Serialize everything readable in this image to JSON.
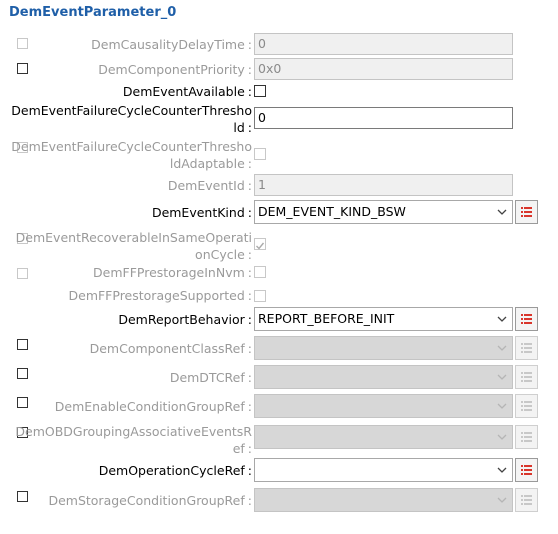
{
  "title": "DemEventParameter_0",
  "colon": ":",
  "rows": {
    "causality": {
      "label": "DemCausalityDelayTime",
      "value": "0"
    },
    "component_priority": {
      "label": "DemComponentPriority",
      "value": "0x0"
    },
    "event_available": {
      "label": "DemEventAvailable"
    },
    "failure_threshold": {
      "label_line1": "DemEventFailureCycleCounterThresho",
      "label_line2": "ld",
      "value": "0"
    },
    "failure_threshold_adaptable": {
      "label_line1": "DemEventFailureCycleCounterThresho",
      "label_line2": "ldAdaptable"
    },
    "event_id": {
      "label": "DemEventId",
      "value": "1"
    },
    "event_kind": {
      "label": "DemEventKind",
      "value": "DEM_EVENT_KIND_BSW"
    },
    "recoverable": {
      "label_line1": "DemEventRecoverableInSameOperati",
      "label_line2": "onCycle",
      "checked": true
    },
    "ff_prestorage_nvm": {
      "label": "DemFFPrestorageInNvm"
    },
    "ff_prestorage_supported": {
      "label": "DemFFPrestorageSupported"
    },
    "report_behavior": {
      "label": "DemReportBehavior",
      "value": "REPORT_BEFORE_INIT"
    },
    "component_class_ref": {
      "label": "DemComponentClassRef",
      "value": ""
    },
    "dtc_ref": {
      "label": "DemDTCRef",
      "value": ""
    },
    "enable_condition_group_ref": {
      "label": "DemEnableConditionGroupRef",
      "value": ""
    },
    "obd_grouping": {
      "label_line1": "DemOBDGroupingAssociativeEventsR",
      "label_line2": "ef",
      "value": ""
    },
    "operation_cycle_ref": {
      "label": "DemOperationCycleRef",
      "value": ""
    },
    "storage_condition_group_ref": {
      "label": "DemStorageConditionGroupRef",
      "value": ""
    }
  },
  "icons": {
    "dropdown": "chevron-down-icon",
    "browse": "list-icon"
  },
  "colors": {
    "title": "#1f5fa8",
    "browse_icon": "#d9352b",
    "disabled_text": "#9a9a9a"
  }
}
